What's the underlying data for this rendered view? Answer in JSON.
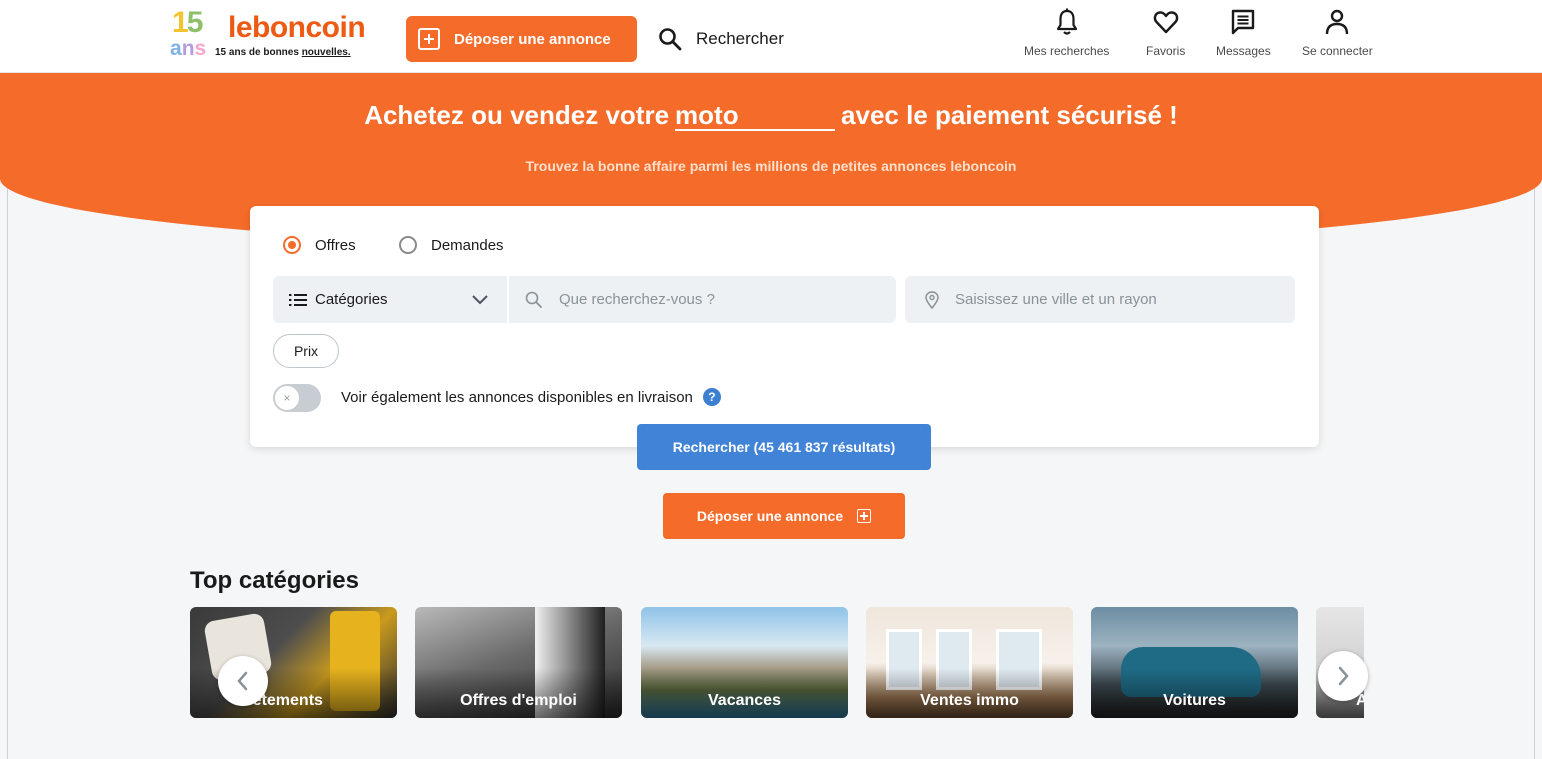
{
  "header": {
    "logo": {
      "number": [
        "1",
        "5"
      ],
      "ans": [
        "a",
        "n",
        "s"
      ],
      "brand": "leboncoin",
      "tagline_prefix": "15 ans de bonnes ",
      "tagline_underlined": "nouvelles."
    },
    "post_button": "Déposer une annonce",
    "search_link": "Rechercher",
    "nav": [
      {
        "label": "Mes recherches",
        "icon": "bell-icon"
      },
      {
        "label": "Favoris",
        "icon": "heart-icon"
      },
      {
        "label": "Messages",
        "icon": "message-icon"
      },
      {
        "label": "Se connecter",
        "icon": "user-icon"
      }
    ]
  },
  "hero": {
    "title_before": "Achetez ou vendez votre",
    "title_word": "moto",
    "title_after": "avec le paiement sécurisé !",
    "subtitle": "Trouvez la bonne affaire parmi les millions de petites annonces leboncoin"
  },
  "search": {
    "radio_offres": "Offres",
    "radio_demandes": "Demandes",
    "category_label": "Catégories",
    "query_placeholder": "Que recherchez-vous ?",
    "location_placeholder": "Saisissez une ville et un rayon",
    "price_chip": "Prix",
    "toggle_knob": "×",
    "delivery_toggle_label": "Voir également les annonces disponibles en livraison",
    "help_glyph": "?",
    "submit_label": "Rechercher (45 461 837 résultats)"
  },
  "post_button_secondary": "Déposer une annonce",
  "top_categories": {
    "title": "Top catégories",
    "items": [
      {
        "label": "Vêtements"
      },
      {
        "label": "Offres d'emploi"
      },
      {
        "label": "Vacances"
      },
      {
        "label": "Ventes immo"
      },
      {
        "label": "Voitures"
      },
      {
        "label": "Ame"
      }
    ]
  },
  "colors": {
    "brand_orange": "#f56b2a",
    "search_blue": "#4183d7",
    "field_bg": "#edf1f4"
  }
}
